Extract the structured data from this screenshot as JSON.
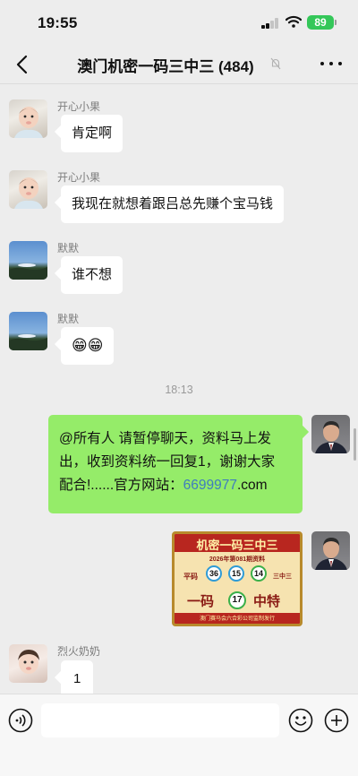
{
  "status_bar": {
    "time": "19:55",
    "battery": "89"
  },
  "header": {
    "title": "澳门机密一码三中三 (484)"
  },
  "messages": [
    {
      "sender": "开心小果",
      "text": "肯定啊"
    },
    {
      "sender": "开心小果",
      "text": "我现在就想着跟吕总先赚个宝马钱"
    },
    {
      "sender": "默默",
      "text": "谁不想"
    },
    {
      "sender": "默默",
      "text": "😁😁"
    },
    {
      "time": "18:13"
    },
    {
      "mine": true,
      "text_line1": "@所有人 请暂停聊天，资料马上发",
      "text_line2": "出，收到资料统一回复1，谢谢大家",
      "text_line3_prefix": "配合!......官方网站：",
      "link": "6699977",
      "text_line3_suffix": ".com"
    },
    {
      "mine": true,
      "image": {
        "title": "机密一码三中三",
        "subtitle": "2026年第081期资料",
        "left_label": "平码",
        "right_label": "三中三",
        "balls": [
          "36",
          "15",
          "14"
        ],
        "special_prefix": "一码",
        "special_ball": "17",
        "special_suffix": "中特",
        "footer": "澳门赛马会六合彩公司监制发行"
      }
    },
    {
      "sender": "烈火奶奶",
      "text": "1"
    }
  ],
  "input_bar": {
    "placeholder": ""
  }
}
